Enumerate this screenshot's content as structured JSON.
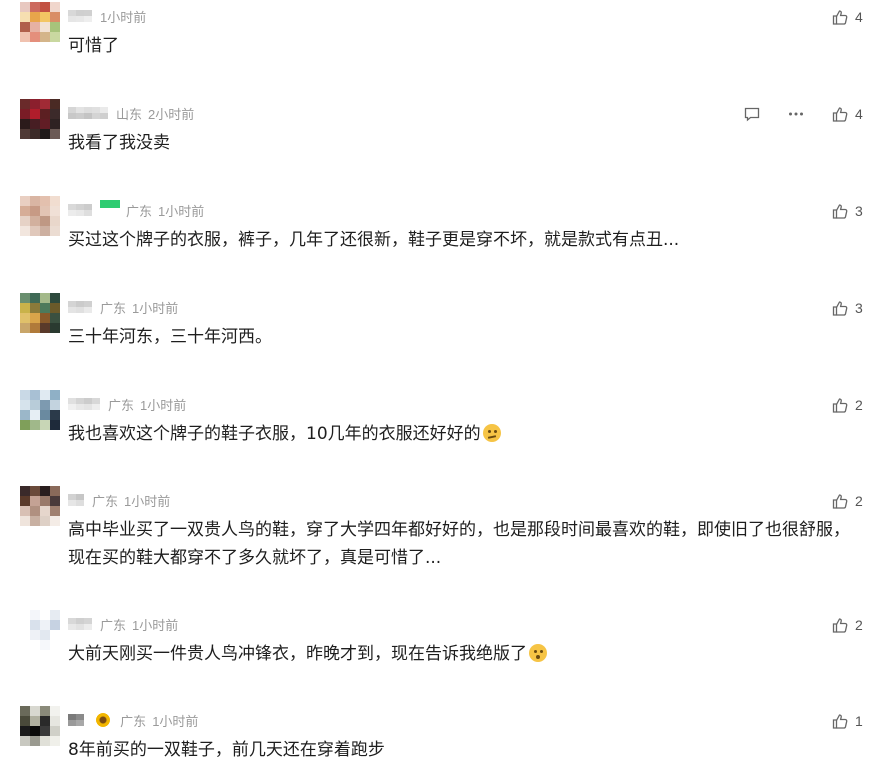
{
  "comments": [
    {
      "location": "",
      "time": "1小时前",
      "text": "可惜了",
      "likes": "4",
      "emoji": "",
      "show_reply": false,
      "avatar": [
        "#e8c8c0",
        "#cc6a5f",
        "#c25243",
        "#f0d6cc",
        "#f6dfb1",
        "#e8a54b",
        "#f3c663",
        "#d98d66",
        "#b05f4b",
        "#e6b1a3",
        "#f2e2d3",
        "#a7c37b",
        "#f0c2b0",
        "#e48f7c",
        "#d4b58a",
        "#c9d8a0"
      ],
      "name": [
        "#d8d8d8",
        "#e6e6e6",
        "#cfcfcf",
        "#e8e8e8",
        "#d0d0d0",
        "#eeeeee"
      ]
    },
    {
      "location": "山东",
      "time": "2小时前",
      "text": "我看了我没卖",
      "likes": "4",
      "emoji": "",
      "show_reply": true,
      "avatar": [
        "#6a2a2a",
        "#8b1f2d",
        "#a02a35",
        "#4a2a24",
        "#7a1c26",
        "#b01d2b",
        "#5c1f22",
        "#3c2a2a",
        "#2b1b1b",
        "#471e23",
        "#611d25",
        "#2e2222",
        "#503a36",
        "#3b2a28",
        "#1f1a1a",
        "#6b5a55"
      ],
      "name": [
        "#d6d6d6",
        "#c8c8c8",
        "#e3e3e3",
        "#cccccc",
        "#dddddd",
        "#c4c4c4",
        "#e0e0e0",
        "#d4d4d4",
        "#eaeaea",
        "#cfcfcf"
      ]
    },
    {
      "location": "广东",
      "time": "1小时前",
      "text": "买过这个牌子的衣服，裤子，几年了还很新，鞋子更是穿不坏，就是款式有点丑...",
      "likes": "3",
      "emoji": "",
      "show_reply": false,
      "avatar": [
        "#e9cfc2",
        "#d9b5a3",
        "#e3c0ae",
        "#f1ddd0",
        "#d6ad97",
        "#c79a85",
        "#e2c4b4",
        "#f0e0d6",
        "#e6d2c6",
        "#d2b09e",
        "#bf9884",
        "#e9d7cb",
        "#f2e6de",
        "#e0c8bb",
        "#cdb0a1",
        "#ebdcd2"
      ],
      "name": [
        "#d9d9d9",
        "#ececec",
        "#d2d2d2",
        "#e8e8e8",
        "#cccccc",
        "#dedede"
      ]
    },
    {
      "location": "广东",
      "time": "1小时前",
      "text": "三十年河东，三十年河西。",
      "likes": "3",
      "emoji": "",
      "show_reply": false,
      "avatar": [
        "#6a8f6f",
        "#3f6a56",
        "#a3b98a",
        "#2e4a3d",
        "#c9b24a",
        "#8a7a3a",
        "#4d7a5c",
        "#6b5a2a",
        "#e0c06a",
        "#d9a44a",
        "#8a5a2a",
        "#3a5040",
        "#c9a66a",
        "#b07a3a",
        "#5a3a2a",
        "#2a3a30"
      ],
      "name": [
        "#d4d4d4",
        "#e4e4e4",
        "#cbcbcb",
        "#e0e0e0",
        "#d0d0d0",
        "#eaeaea"
      ]
    },
    {
      "location": "广东",
      "time": "1小时前",
      "text": "我也喜欢这个牌子的鞋子衣服，10几年的衣服还好好的",
      "likes": "2",
      "emoji": "think",
      "show_reply": false,
      "avatar": [
        "#c9d9e6",
        "#a8c0d4",
        "#e0eaf2",
        "#8fb0c6",
        "#d6e3ec",
        "#b8ccd9",
        "#7d9ab0",
        "#c3d3df",
        "#9bb7c9",
        "#e6eef4",
        "#6a8aa0",
        "#2b3a4a",
        "#7f9f5a",
        "#a0b88a",
        "#c8d6b6",
        "#1e2a3a"
      ],
      "name": [
        "#e0e0e0",
        "#f0f0f0",
        "#d4d4d4",
        "#e8e8e8",
        "#cccccc",
        "#e4e4e4",
        "#d8d8d8",
        "#eeeeee"
      ]
    },
    {
      "location": "广东",
      "time": "1小时前",
      "text": "高中毕业买了一双贵人鸟的鞋，穿了大学四年都好好的，也是那段时间最喜欢的鞋，即使旧了也很舒服，现在买的鞋大都穿不了多久就坏了，真是可惜了...",
      "likes": "2",
      "emoji": "",
      "show_reply": false,
      "avatar": [
        "#3a2a2a",
        "#6a4a3a",
        "#2a1e1e",
        "#8a6a5a",
        "#5a3a2a",
        "#c4a294",
        "#9a7a6a",
        "#4a3a3a",
        "#d8c0b4",
        "#b09080",
        "#e6d6cc",
        "#a08070",
        "#efe4dc",
        "#c8b0a2",
        "#ded0c6",
        "#f4ece6"
      ],
      "name": [
        "#d2d2d2",
        "#e6e6e6",
        "#c6c6c6",
        "#dedede"
      ]
    },
    {
      "location": "广东",
      "time": "1小时前",
      "text": "大前天刚买一件贵人鸟冲锋衣，昨晚才到，现在告诉我绝版了",
      "likes": "2",
      "emoji": "shocked",
      "show_reply": false,
      "avatar": [
        "#ffffff",
        "#f4f6fa",
        "#ffffff",
        "#e6ebf2",
        "#ffffff",
        "#d9e1ec",
        "#eef2f7",
        "#c6d2e2",
        "#ffffff",
        "#eef1f6",
        "#e2e8f0",
        "#ffffff",
        "#ffffff",
        "#ffffff",
        "#f6f8fb",
        "#ffffff"
      ],
      "name": [
        "#d8d8d8",
        "#e8e8e8",
        "#cfcfcf",
        "#e2e2e2",
        "#d4d4d4",
        "#ececec"
      ]
    },
    {
      "location": "广东",
      "time": "1小时前",
      "text": "8年前买的一双鞋子，前几天还在穿着跑步",
      "likes": "1",
      "emoji": "",
      "show_reply": false,
      "avatar": [
        "#6a6a5a",
        "#d8d8d0",
        "#8a8a7a",
        "#f2f2ee",
        "#4a4a3a",
        "#b0b0a0",
        "#2a2a2a",
        "#e6e6e0",
        "#1a1a1a",
        "#0a0a0a",
        "#3a3a3a",
        "#d0d0c8",
        "#c8c8c0",
        "#9a9a90",
        "#e0e0d8",
        "#f0f0ea"
      ],
      "name": [
        "#7a7a7a",
        "#9a9a9a",
        "#8a8a8a",
        "#a8a8a8"
      ]
    }
  ]
}
